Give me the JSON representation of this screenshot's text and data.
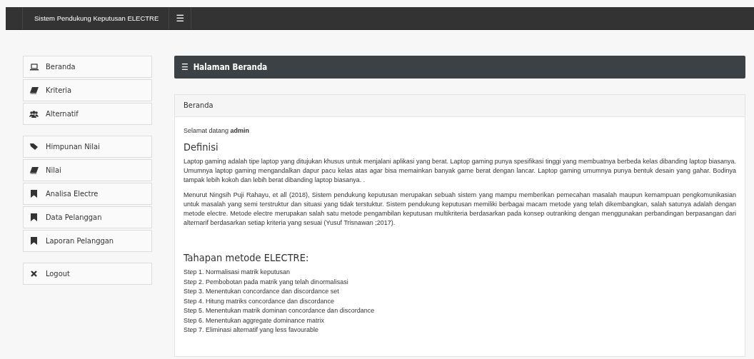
{
  "topbar": {
    "title": "Sistem Pendukung Keputusan ELECTRE",
    "menu_icon": "☰"
  },
  "sidebar": {
    "groups": [
      {
        "items": [
          {
            "label": "Beranda",
            "kind": "laptop"
          },
          {
            "label": "Kriteria",
            "kind": "book"
          },
          {
            "label": "Alternatif",
            "kind": "users"
          }
        ]
      },
      {
        "items": [
          {
            "label": "Himpunan Nilai",
            "kind": "tag"
          },
          {
            "label": "Nilai",
            "kind": "book"
          },
          {
            "label": "Analisa Electre",
            "kind": "bookmark"
          },
          {
            "label": "Data Pelanggan",
            "kind": "bookmark"
          },
          {
            "label": "Laporan Pelanggan",
            "kind": "bookmark"
          }
        ]
      },
      {
        "items": [
          {
            "label": "Logout",
            "kind": "close"
          }
        ]
      }
    ]
  },
  "page_header": {
    "icon": "☰",
    "title": "Halaman Beranda"
  },
  "panel": {
    "heading": "Beranda",
    "welcome": "Selamat datang **admin**",
    "sections": [
      {
        "title": "Definisi",
        "paragraphs": [
          "Laptop gaming adalah tipe laptop yang ditujukan khusus untuk menjalani aplikasi yang berat. Laptop gaming punya spesifikasi tinggi yang membuatnya berbeda kelas dibanding laptop biasanya. Umumnya laptop gaming mengandalkan dapur pacu kelas atas agar bisa memainkan banyak game berat dengan lancar. Laptop gaming umumnya punya bentuk desain yang gahar. Bodinya tampak lebih kokoh dan lebih berat dibanding laptop biasanya. .",
          "Menurut Ningsih Puji Rahayu, et all (2018), Sistem pendukung keputusan merupakan sebuah sistem yang mampu memberikan pemecahan masalah maupun kemampuan pengkomunikasian untuk masalah yang semi terstruktur dan situasi yang tidak terstuktur. Sistem pendukung keputusan memiliki berbagai macam metode yang telah dikembangkan, salah satunya adalah dengan metode electre. Metode electre merupakan salah satu metode pengambilan keputusan multikriteria berdasarkan pada konsep outranking dengan menggunakan perbandingan berpasangan dari alternarif berdasarkan setiap kriteria yang sesuai (Yusuf Trisnawan ;2017)."
        ]
      },
      {
        "title": "Tahapan metode ELECTRE:",
        "steps": [
          "Step 1. Normalisasi matrik keputusan",
          "Step 2. Pembobotan pada matrik yang telah dinormalisasi",
          "Step 3. Menentukan concordance dan discordance set",
          "Step 4. Hitung matriks concordance dan discordance",
          "Step 5. Menentukan matrik dominan concordance dan discordance",
          "Step 6. Menentukan aggregate dominance matrix",
          "Step 7. Eliminasi alternatif yang less favourable"
        ]
      }
    ]
  }
}
